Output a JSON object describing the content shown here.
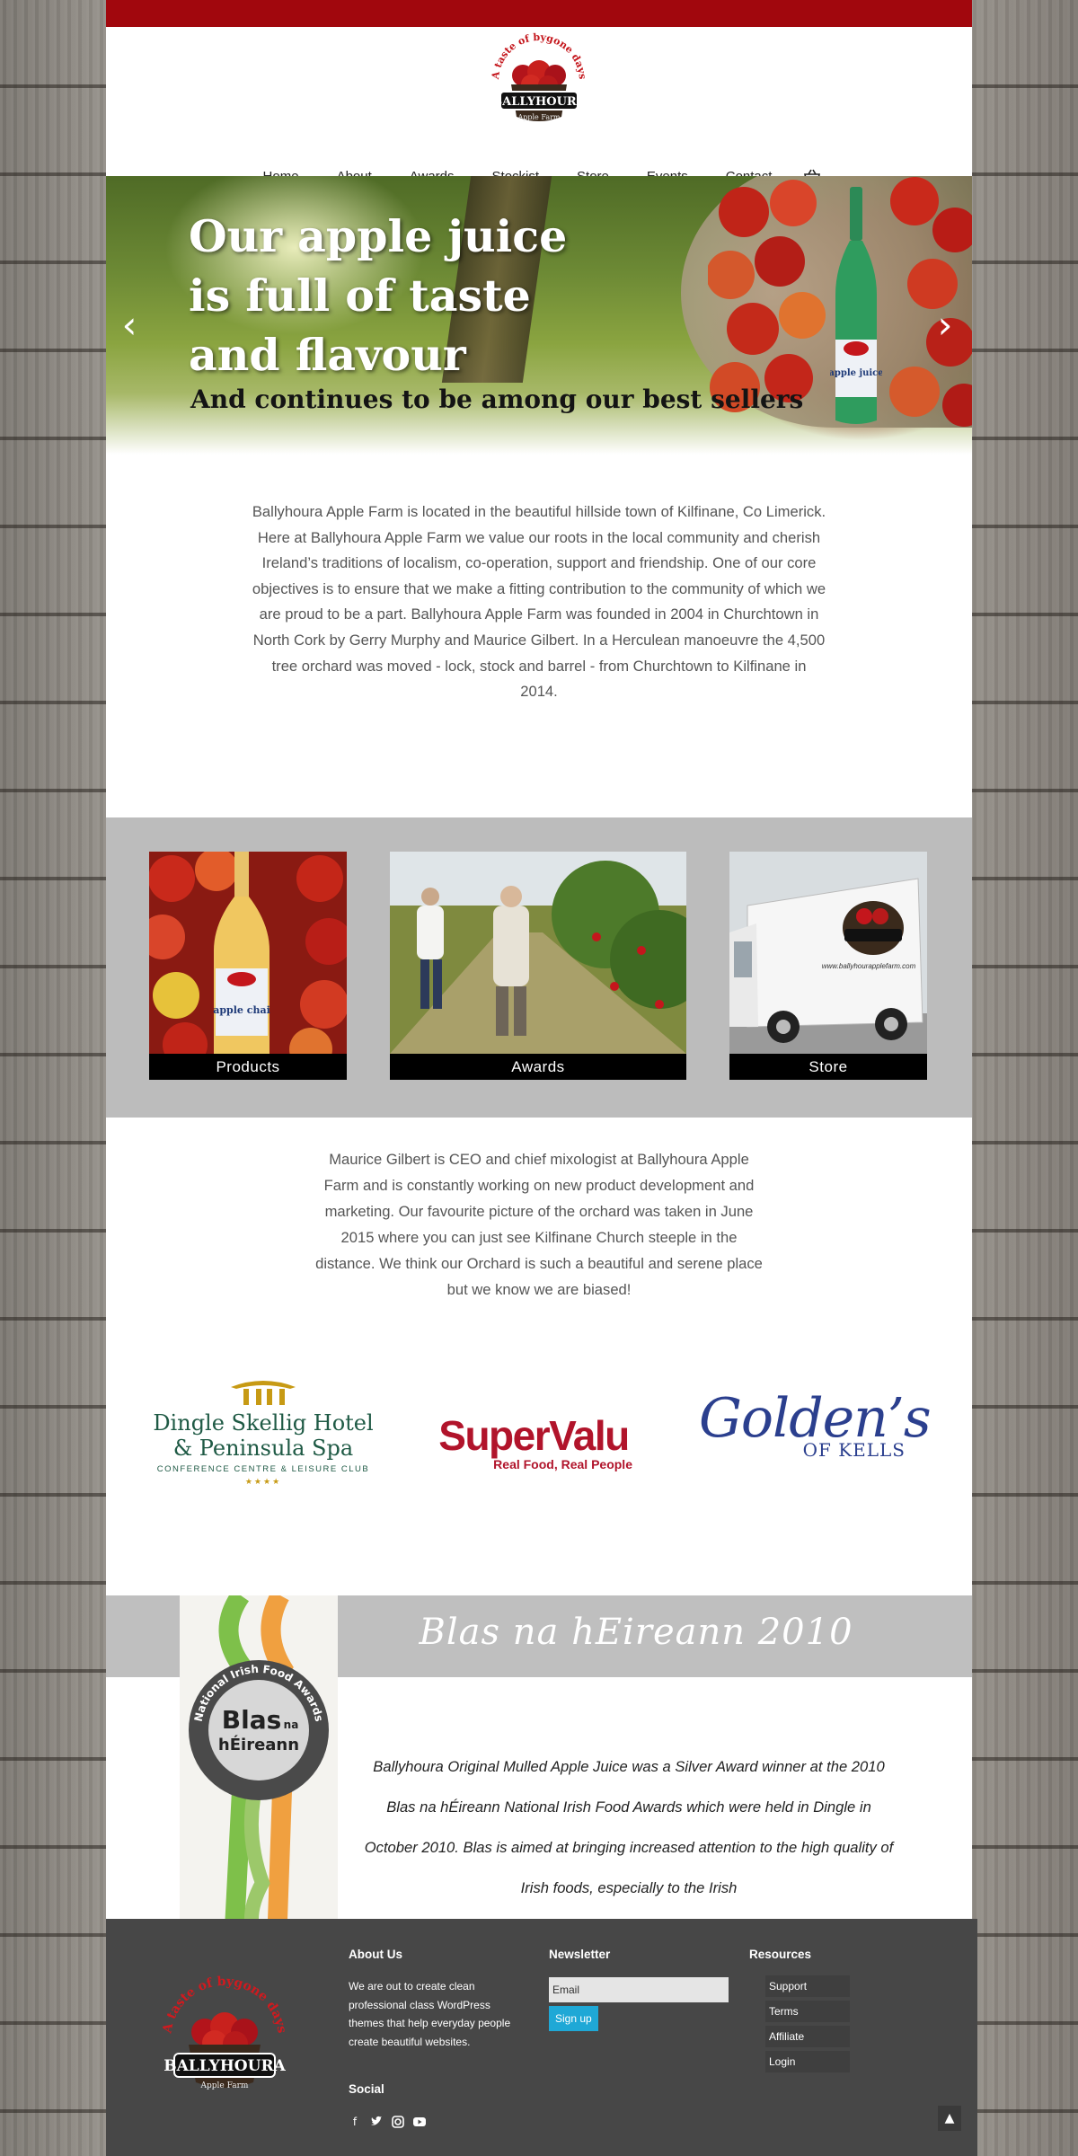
{
  "brand": {
    "logo_arc_text": "A taste of bygone days",
    "logo_name": "BALLYHOURA",
    "logo_sub": "Apple Farm"
  },
  "nav": {
    "items": [
      {
        "label": "Home"
      },
      {
        "label": "About"
      },
      {
        "label": "Awards"
      },
      {
        "label": "Stockist"
      },
      {
        "label": "Store"
      },
      {
        "label": "Events"
      },
      {
        "label": "Contact"
      }
    ],
    "cart_icon": "basket-icon"
  },
  "hero": {
    "title_line1": "Our apple juice",
    "title_line2": "is full of taste",
    "title_line3": "and flavour",
    "subtitle": "And continues to be among our best sellers",
    "bottle_label": "apple juice",
    "prev_icon": "chevron-left-icon",
    "next_icon": "chevron-right-icon"
  },
  "intro": {
    "text": "Ballyhoura Apple Farm is located in the beautiful hillside town of Kilfinane, Co Limerick.  Here at Ballyhoura Apple Farm we value our roots in the local community and cherish Ireland’s traditions of localism, co-operation, support and friendship.  One of our core objectives is to ensure that we make a fitting contribution to the community of which we are proud to be a part. Ballyhoura Apple Farm was founded in 2004 in Churchtown in North Cork by Gerry Murphy and Maurice Gilbert. In a Herculean manoeuvre the 4,500 tree orchard was moved - lock, stock and barrel - from Churchtown to Kilfinane in 2014."
  },
  "tiles": [
    {
      "caption": "Products",
      "bottle_label": "apple chai"
    },
    {
      "caption": "Awards"
    },
    {
      "caption": "Store",
      "van_url": "www.ballyhourapplefarm.com"
    }
  ],
  "about": {
    "text": "Maurice Gilbert is CEO and chief mixologist at Ballyhoura Apple Farm and is constantly working on new product development and marketing. Our favourite picture of the orchard was taken in June 2015 where you can just see Kilfinane Church steeple in the distance. We think our Orchard is such a beautiful and serene place but we know we are biased!"
  },
  "stockists": {
    "dingle_line1": "Dingle Skellig Hotel",
    "dingle_line2": "& Peninsula Spa",
    "dingle_tag": "CONFERENCE CENTRE & LEISURE CLUB",
    "dingle_stars": "★★★★",
    "supervalu_name": "SuperValu",
    "supervalu_tag": "Real Food, Real People",
    "goldens_name": "Golden’s",
    "goldens_sub": "OF KELLS"
  },
  "blas": {
    "title": "Blas na hEireann 2010",
    "badge_ring": "National Irish Food Awards",
    "badge_center1": "Blas",
    "badge_center2": "na",
    "badge_center3": "hÉireann",
    "text": "Ballyhoura Original Mulled Apple Juice was a Silver Award winner at the 2010 Blas na hÉireann National Irish Food Awards which were held in Dingle in October 2010. Blas is aimed at bringing increased attention to the high quality of Irish foods, especially to the Irish"
  },
  "footer": {
    "about_heading": "About Us",
    "about_text": "We are out to create clean professional class WordPress themes that help everyday people create beautiful websites.",
    "social_heading": "Social",
    "social_icons": [
      "facebook-icon",
      "twitter-icon",
      "instagram-icon",
      "youtube-icon"
    ],
    "newsletter_heading": "Newsletter",
    "email_placeholder": "Email",
    "signup_label": "Sign up",
    "resources_heading": "Resources",
    "resources": [
      "Support",
      "Terms",
      "Affiliate",
      "Login"
    ],
    "back_to_top_icon": "arrow-up-icon"
  },
  "colors": {
    "topbar": "#a1070d",
    "signup_button": "#1fa8d6",
    "footer_bg": "#474747",
    "band_gray": "#bcbcbc"
  }
}
